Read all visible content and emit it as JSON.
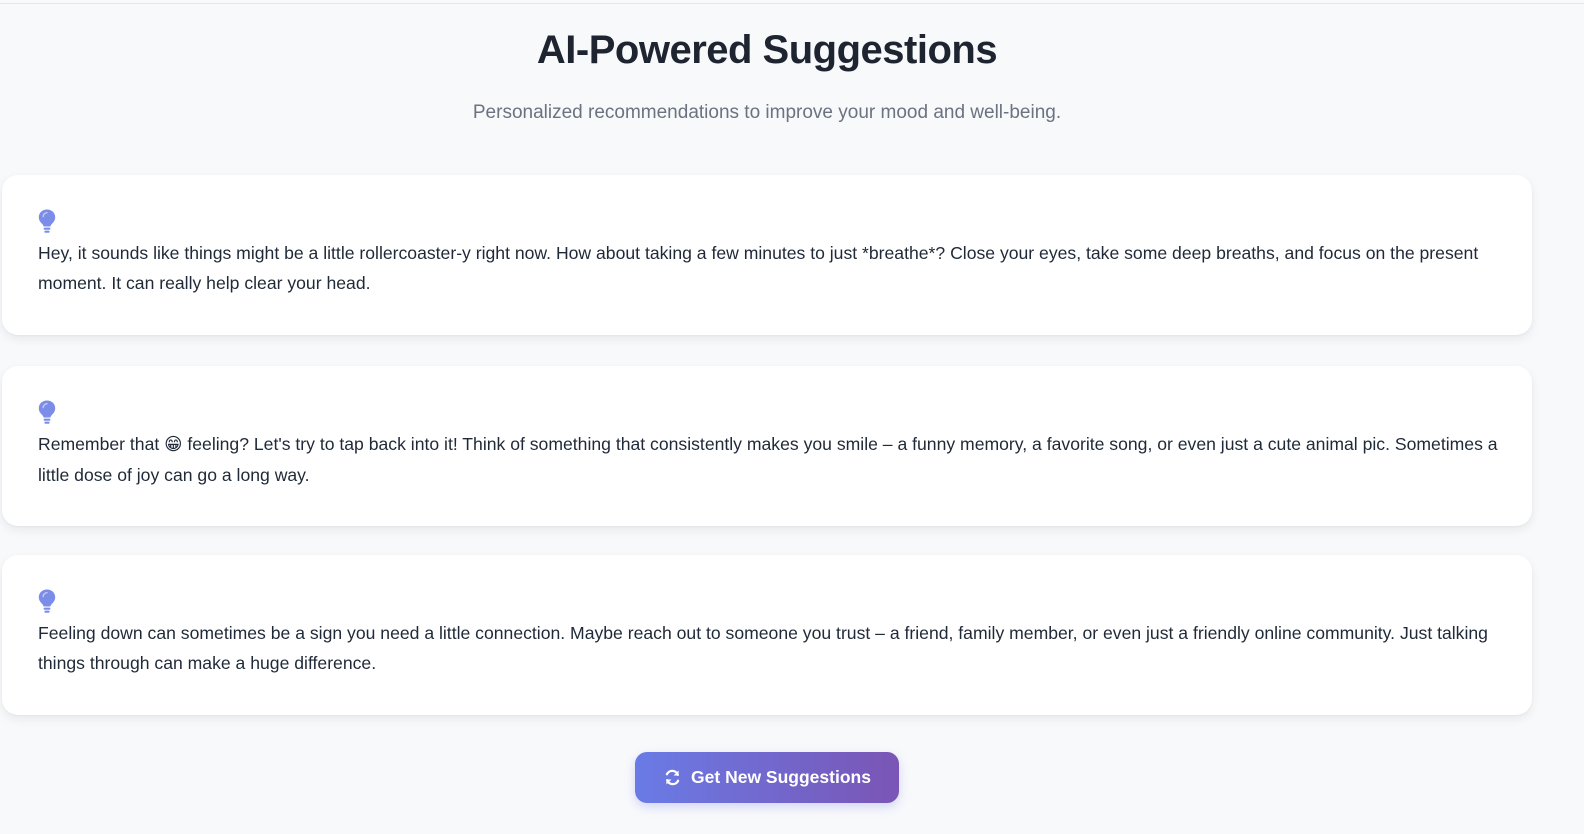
{
  "header": {
    "title": "AI-Powered Suggestions",
    "subtitle": "Personalized recommendations to improve your mood and well-being."
  },
  "suggestions": [
    {
      "icon": "lightbulb-icon",
      "text": "Hey, it sounds like things might be a little rollercoaster-y right now. How about taking a few minutes to just *breathe*? Close your eyes, take some deep breaths, and focus on the present moment. It can really help clear your head."
    },
    {
      "icon": "lightbulb-icon",
      "text_before": "Remember that ",
      "emoji": "😁",
      "text_after": " feeling? Let's try to tap back into it! Think of something that consistently makes you smile – a funny memory, a favorite song, or even just a cute animal pic. Sometimes a little dose of joy can go a long way."
    },
    {
      "icon": "lightbulb-icon",
      "text": "Feeling down can sometimes be a sign you need a little connection. Maybe reach out to someone you trust – a friend, family member, or even just a friendly online community. Just talking things through can make a huge difference."
    }
  ],
  "actions": {
    "refresh_label": "Get New Suggestions",
    "refresh_icon": "refresh-icon"
  },
  "colors": {
    "accent_start": "#6a7be6",
    "accent_end": "#7a55b5",
    "icon": "#7b8de8",
    "background": "#f8f9fb",
    "card": "#ffffff"
  }
}
